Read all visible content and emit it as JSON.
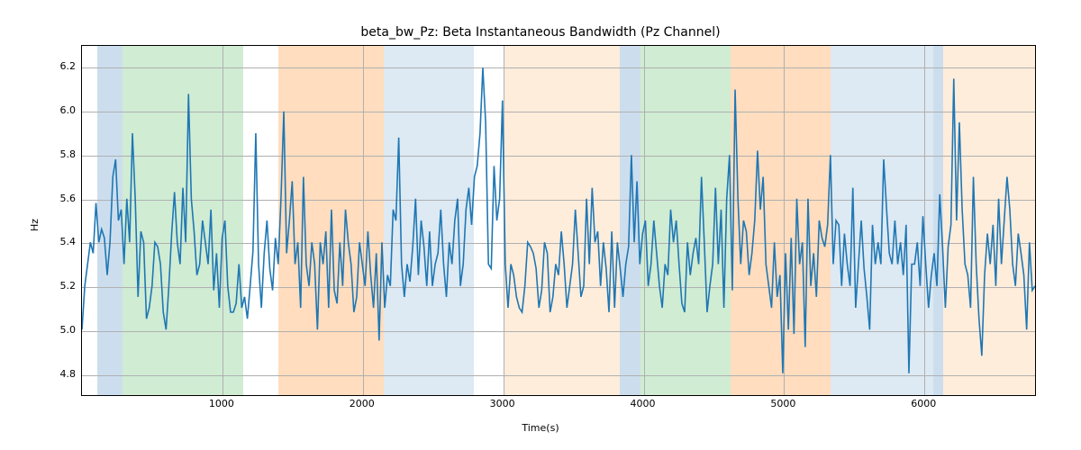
{
  "chart_data": {
    "type": "line",
    "title": "beta_bw_Pz: Beta Instantaneous Bandwidth (Pz Channel)",
    "xlabel": "Time(s)",
    "ylabel": "Hz",
    "xlim": [
      0,
      6800
    ],
    "ylim": [
      4.7,
      6.3
    ],
    "x_ticks": [
      1000,
      2000,
      3000,
      4000,
      5000,
      6000
    ],
    "y_ticks": [
      4.8,
      5.0,
      5.2,
      5.4,
      5.6,
      5.8,
      6.0,
      6.2
    ],
    "x": [
      0,
      20,
      40,
      60,
      80,
      100,
      120,
      140,
      160,
      180,
      200,
      220,
      240,
      260,
      280,
      300,
      320,
      340,
      360,
      380,
      400,
      420,
      440,
      460,
      480,
      500,
      520,
      540,
      560,
      580,
      600,
      620,
      640,
      660,
      680,
      700,
      720,
      740,
      760,
      780,
      800,
      820,
      840,
      860,
      880,
      900,
      920,
      940,
      960,
      980,
      1000,
      1020,
      1040,
      1060,
      1080,
      1100,
      1120,
      1140,
      1160,
      1180,
      1200,
      1220,
      1240,
      1260,
      1280,
      1300,
      1320,
      1340,
      1360,
      1380,
      1400,
      1420,
      1440,
      1460,
      1480,
      1500,
      1520,
      1540,
      1560,
      1580,
      1600,
      1620,
      1640,
      1660,
      1680,
      1700,
      1720,
      1740,
      1760,
      1780,
      1800,
      1820,
      1840,
      1860,
      1880,
      1900,
      1920,
      1940,
      1960,
      1980,
      2000,
      2020,
      2040,
      2060,
      2080,
      2100,
      2120,
      2140,
      2160,
      2180,
      2200,
      2220,
      2240,
      2260,
      2280,
      2300,
      2320,
      2340,
      2360,
      2380,
      2400,
      2420,
      2440,
      2460,
      2480,
      2500,
      2520,
      2540,
      2560,
      2580,
      2600,
      2620,
      2640,
      2660,
      2680,
      2700,
      2720,
      2740,
      2760,
      2780,
      2800,
      2820,
      2840,
      2860,
      2880,
      2900,
      2920,
      2940,
      2960,
      2980,
      3000,
      3020,
      3040,
      3060,
      3080,
      3100,
      3120,
      3140,
      3160,
      3180,
      3200,
      3220,
      3240,
      3260,
      3280,
      3300,
      3320,
      3340,
      3360,
      3380,
      3400,
      3420,
      3440,
      3460,
      3480,
      3500,
      3520,
      3540,
      3560,
      3580,
      3600,
      3620,
      3640,
      3660,
      3680,
      3700,
      3720,
      3740,
      3760,
      3780,
      3800,
      3820,
      3840,
      3860,
      3880,
      3900,
      3920,
      3940,
      3960,
      3980,
      4000,
      4020,
      4040,
      4060,
      4080,
      4100,
      4120,
      4140,
      4160,
      4180,
      4200,
      4220,
      4240,
      4260,
      4280,
      4300,
      4320,
      4340,
      4360,
      4380,
      4400,
      4420,
      4440,
      4460,
      4480,
      4500,
      4520,
      4540,
      4560,
      4580,
      4600,
      4620,
      4640,
      4660,
      4680,
      4700,
      4720,
      4740,
      4760,
      4780,
      4800,
      4820,
      4840,
      4860,
      4880,
      4900,
      4920,
      4940,
      4960,
      4980,
      5000,
      5020,
      5040,
      5060,
      5080,
      5100,
      5120,
      5140,
      5160,
      5180,
      5200,
      5220,
      5240,
      5260,
      5280,
      5300,
      5320,
      5340,
      5360,
      5380,
      5400,
      5420,
      5440,
      5460,
      5480,
      5500,
      5520,
      5540,
      5560,
      5580,
      5600,
      5620,
      5640,
      5660,
      5680,
      5700,
      5720,
      5740,
      5760,
      5780,
      5800,
      5820,
      5840,
      5860,
      5880,
      5900,
      5920,
      5940,
      5960,
      5980,
      6000,
      6020,
      6040,
      6060,
      6080,
      6100,
      6120,
      6140,
      6160,
      6180,
      6200,
      6220,
      6240,
      6260,
      6280,
      6300,
      6320,
      6340,
      6360,
      6380,
      6400,
      6420,
      6440,
      6460,
      6480,
      6500,
      6520,
      6540,
      6560,
      6580,
      6600,
      6620,
      6640,
      6660,
      6680,
      6700,
      6720,
      6740,
      6760,
      6780,
      6800
    ],
    "values": [
      5.0,
      5.2,
      5.3,
      5.4,
      5.35,
      5.58,
      5.4,
      5.46,
      5.42,
      5.25,
      5.4,
      5.7,
      5.78,
      5.5,
      5.55,
      5.3,
      5.6,
      5.4,
      5.9,
      5.6,
      5.15,
      5.45,
      5.4,
      5.05,
      5.1,
      5.2,
      5.4,
      5.38,
      5.3,
      5.08,
      5.0,
      5.2,
      5.44,
      5.63,
      5.4,
      5.3,
      5.65,
      5.4,
      6.08,
      5.6,
      5.45,
      5.25,
      5.3,
      5.5,
      5.4,
      5.3,
      5.55,
      5.18,
      5.35,
      5.1,
      5.42,
      5.5,
      5.2,
      5.08,
      5.08,
      5.12,
      5.3,
      5.1,
      5.15,
      5.05,
      5.2,
      5.36,
      5.9,
      5.3,
      5.1,
      5.35,
      5.5,
      5.28,
      5.18,
      5.42,
      5.3,
      5.6,
      6.0,
      5.35,
      5.5,
      5.68,
      5.3,
      5.4,
      5.1,
      5.7,
      5.3,
      5.2,
      5.4,
      5.3,
      5.0,
      5.4,
      5.3,
      5.45,
      5.1,
      5.55,
      5.18,
      5.12,
      5.4,
      5.2,
      5.55,
      5.4,
      5.3,
      5.08,
      5.15,
      5.4,
      5.3,
      5.2,
      5.45,
      5.25,
      5.1,
      5.35,
      4.95,
      5.4,
      5.1,
      5.25,
      5.2,
      5.55,
      5.5,
      5.88,
      5.3,
      5.15,
      5.3,
      5.22,
      5.38,
      5.6,
      5.25,
      5.5,
      5.38,
      5.2,
      5.45,
      5.2,
      5.3,
      5.35,
      5.55,
      5.3,
      5.15,
      5.4,
      5.3,
      5.5,
      5.6,
      5.2,
      5.3,
      5.55,
      5.65,
      5.48,
      5.7,
      5.75,
      5.9,
      6.2,
      5.95,
      5.3,
      5.28,
      5.75,
      5.5,
      5.6,
      6.05,
      5.3,
      5.1,
      5.3,
      5.25,
      5.15,
      5.1,
      5.08,
      5.2,
      5.4,
      5.38,
      5.35,
      5.28,
      5.1,
      5.18,
      5.4,
      5.35,
      5.08,
      5.15,
      5.3,
      5.25,
      5.45,
      5.3,
      5.1,
      5.2,
      5.3,
      5.55,
      5.35,
      5.15,
      5.2,
      5.6,
      5.3,
      5.65,
      5.4,
      5.45,
      5.2,
      5.4,
      5.28,
      5.08,
      5.45,
      5.1,
      5.4,
      5.28,
      5.15,
      5.3,
      5.38,
      5.8,
      5.4,
      5.68,
      5.3,
      5.44,
      5.5,
      5.2,
      5.3,
      5.5,
      5.35,
      5.2,
      5.1,
      5.3,
      5.25,
      5.55,
      5.4,
      5.5,
      5.3,
      5.12,
      5.08,
      5.4,
      5.25,
      5.35,
      5.42,
      5.3,
      5.7,
      5.4,
      5.08,
      5.2,
      5.3,
      5.65,
      5.3,
      5.55,
      5.1,
      5.6,
      5.8,
      5.18,
      6.1,
      5.6,
      5.3,
      5.5,
      5.45,
      5.25,
      5.35,
      5.5,
      5.82,
      5.55,
      5.7,
      5.3,
      5.2,
      5.1,
      5.4,
      5.15,
      5.25,
      4.8,
      5.35,
      5.0,
      5.42,
      4.98,
      5.6,
      5.3,
      5.4,
      4.92,
      5.6,
      5.2,
      5.35,
      5.15,
      5.5,
      5.42,
      5.38,
      5.48,
      5.8,
      5.3,
      5.5,
      5.48,
      5.2,
      5.44,
      5.3,
      5.2,
      5.65,
      5.1,
      5.3,
      5.5,
      5.28,
      5.15,
      5.0,
      5.48,
      5.3,
      5.4,
      5.3,
      5.78,
      5.56,
      5.35,
      5.3,
      5.5,
      5.3,
      5.4,
      5.25,
      5.48,
      4.8,
      5.3,
      5.3,
      5.4,
      5.2,
      5.52,
      5.3,
      5.1,
      5.25,
      5.35,
      5.2,
      5.62,
      5.38,
      5.1,
      5.38,
      5.48,
      6.15,
      5.5,
      5.95,
      5.55,
      5.3,
      5.25,
      5.1,
      5.7,
      5.3,
      5.05,
      4.88,
      5.25,
      5.44,
      5.3,
      5.48,
      5.2,
      5.6,
      5.3,
      5.5,
      5.7,
      5.55,
      5.3,
      5.2,
      5.44,
      5.35,
      5.25,
      5.0,
      5.4,
      5.18,
      5.2
    ],
    "line_color": "#1f77b4",
    "bands": [
      {
        "start": 110,
        "end": 290,
        "kind": "blue"
      },
      {
        "start": 290,
        "end": 1150,
        "kind": "green"
      },
      {
        "start": 1400,
        "end": 2150,
        "kind": "orange"
      },
      {
        "start": 2150,
        "end": 2790,
        "kind": "lblue"
      },
      {
        "start": 3010,
        "end": 3830,
        "kind": "lorange"
      },
      {
        "start": 3830,
        "end": 3975,
        "kind": "blue"
      },
      {
        "start": 3975,
        "end": 4620,
        "kind": "green"
      },
      {
        "start": 4620,
        "end": 5330,
        "kind": "orange"
      },
      {
        "start": 5330,
        "end": 6060,
        "kind": "lblue"
      },
      {
        "start": 6060,
        "end": 6130,
        "kind": "blue"
      },
      {
        "start": 6130,
        "end": 6800,
        "kind": "lorange"
      }
    ]
  }
}
